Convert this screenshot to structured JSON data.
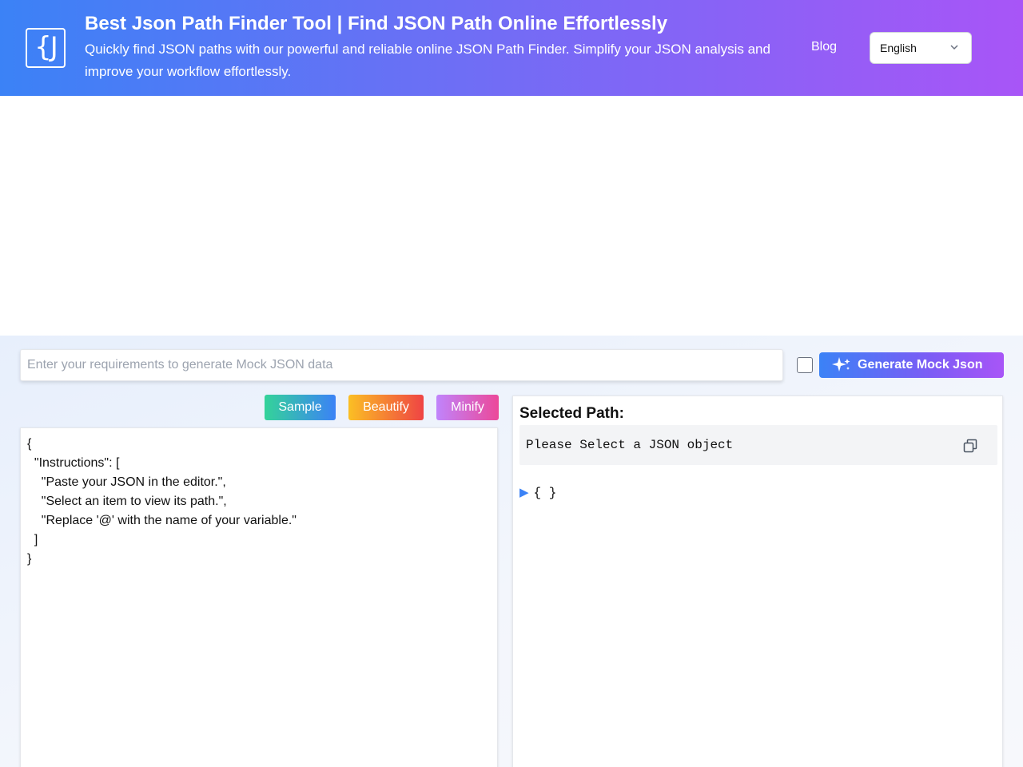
{
  "header": {
    "logo_text": "{J",
    "title": "Best Json Path Finder Tool | Find JSON Path Online Effortlessly",
    "subtitle": "Quickly find JSON paths with our powerful and reliable online JSON Path Finder. Simplify your JSON analysis and improve your workflow effortlessly.",
    "nav": {
      "blog": "Blog"
    },
    "language": {
      "selected": "English",
      "icon": "chevron-down-icon"
    }
  },
  "mock": {
    "placeholder": "Enter your requirements to generate Mock JSON data",
    "value": "",
    "checkbox_checked": false,
    "generate_label": "Generate Mock Json",
    "generate_icon": "sparkle-icon"
  },
  "toolbar": {
    "sample": "Sample",
    "beautify": "Beautify",
    "minify": "Minify"
  },
  "editor": {
    "lines": [
      "{",
      "  \"Instructions\": [",
      "    \"Paste your JSON in the editor.\",",
      "    \"Select an item to view its path.\",",
      "    \"Replace '@' with the name of your variable.\"",
      "  ]",
      "}"
    ]
  },
  "path": {
    "heading": "Selected Path:",
    "value": "Please Select a JSON object",
    "copy_icon": "copy-icon",
    "tree_toggle": "▶",
    "tree_root": "{ }"
  },
  "colors": {
    "header_gradient_start": "#3b82f6",
    "header_gradient_end": "#a855f7",
    "sample_start": "#34d399",
    "sample_end": "#3b82f6",
    "beautify_start": "#fbbf24",
    "beautify_end": "#ef4444",
    "minify_start": "#c084fc",
    "minify_end": "#ec4899",
    "tree_toggle": "#3b82f6"
  }
}
